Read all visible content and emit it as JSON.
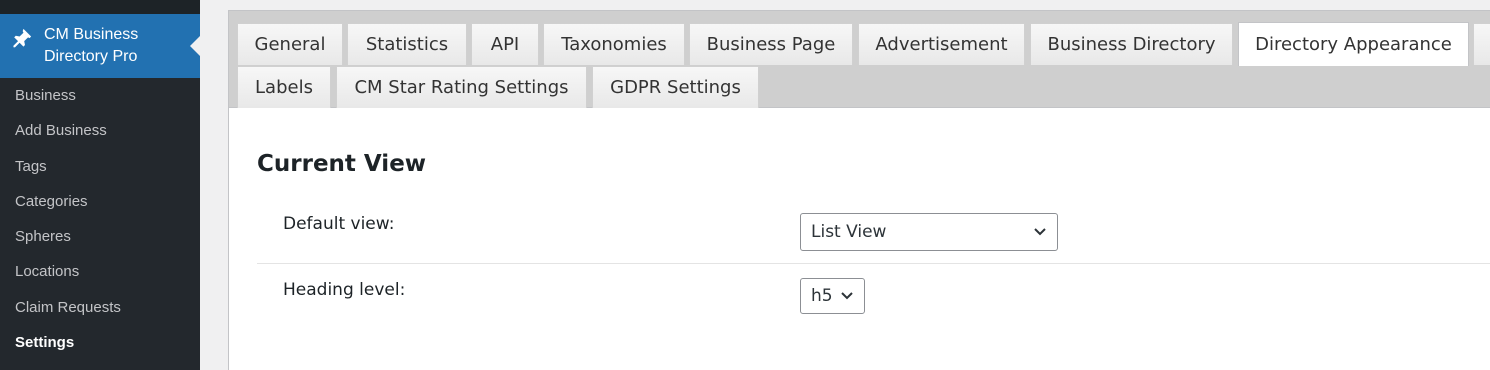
{
  "sidebar": {
    "current": {
      "title_line1": "CM Business",
      "title_line2": "Directory Pro",
      "icon": "pushpin-icon"
    },
    "items": [
      {
        "label": "Business"
      },
      {
        "label": "Add Business"
      },
      {
        "label": "Tags"
      },
      {
        "label": "Categories"
      },
      {
        "label": "Spheres"
      },
      {
        "label": "Locations"
      },
      {
        "label": "Claim Requests"
      },
      {
        "label": "Settings",
        "active": true
      }
    ]
  },
  "tabs": {
    "row1": [
      "General",
      "Statistics",
      "API",
      "Taxonomies",
      "Business Page",
      "Advertisement",
      "Business Directory",
      "Directory Appearance"
    ],
    "row2": [
      "Labels",
      "CM Star Rating Settings",
      "GDPR Settings"
    ],
    "active": "Directory Appearance"
  },
  "section": {
    "title": "Current View",
    "fields": [
      {
        "label": "Default view:",
        "value": "List View"
      },
      {
        "label": "Heading level:",
        "value": "h5"
      }
    ]
  },
  "colors": {
    "sidebar_bg": "#23282d",
    "accent": "#2271b1",
    "sidebar_text": "#c3c4c7"
  }
}
